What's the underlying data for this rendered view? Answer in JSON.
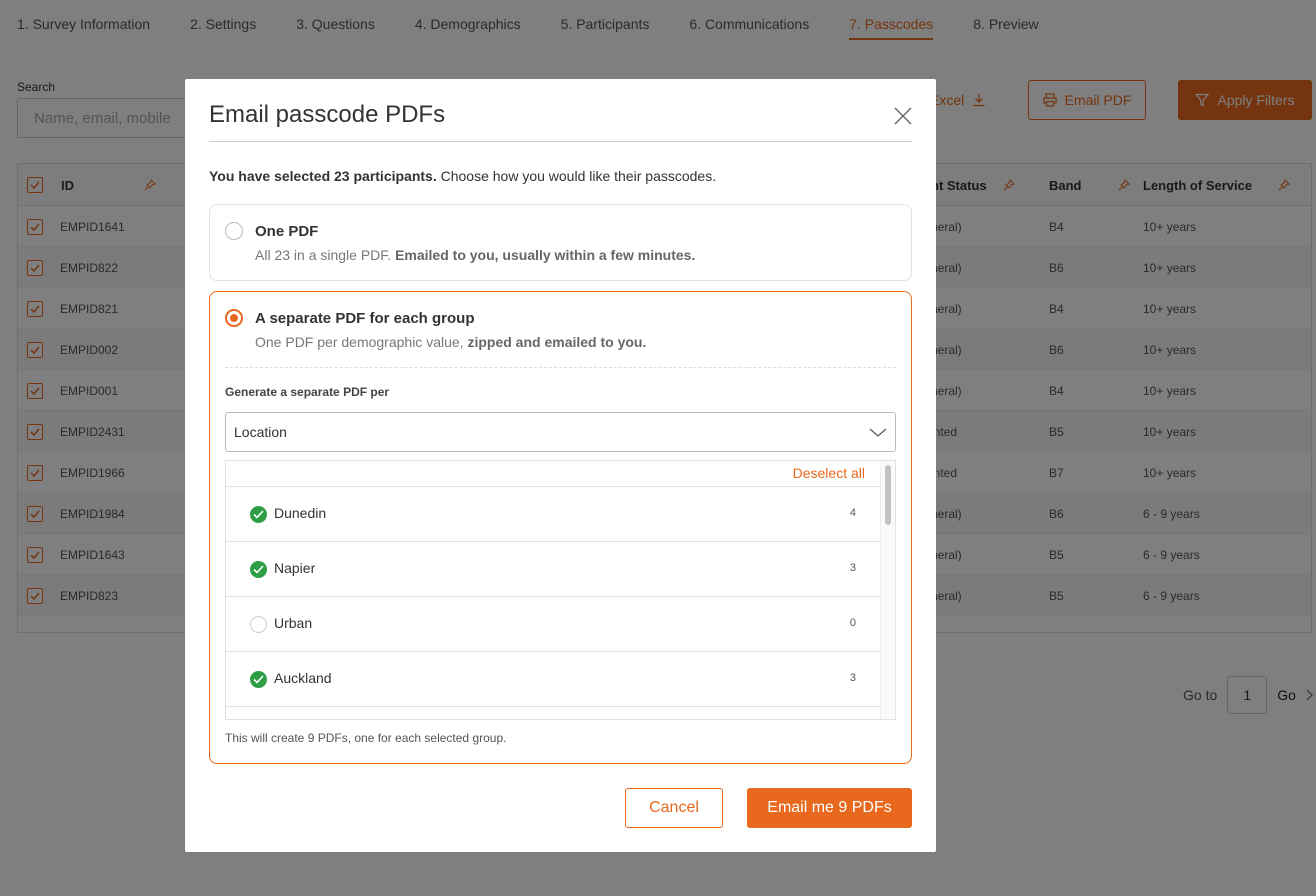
{
  "steps": [
    {
      "label": "1. Survey Information"
    },
    {
      "label": "2. Settings"
    },
    {
      "label": "3. Questions"
    },
    {
      "label": "4. Demographics"
    },
    {
      "label": "5. Participants"
    },
    {
      "label": "6. Communications"
    },
    {
      "label": "7. Passcodes",
      "active": true
    },
    {
      "label": "8. Preview"
    }
  ],
  "search": {
    "label": "Search",
    "placeholder": "Name, email, mobile"
  },
  "toolbar": {
    "excel_label": "Excel",
    "email_pdf_label": "Email PDF",
    "apply_filters_label": "Apply Filters"
  },
  "table": {
    "columns": {
      "id": "ID",
      "status": "nt Status",
      "band": "Band",
      "service": "Length of Service"
    },
    "rows": [
      {
        "id": "EMPID1641",
        "status": "neral)",
        "band": "B4",
        "service": "10+ years"
      },
      {
        "id": "EMPID822",
        "status": "neral)",
        "band": "B6",
        "service": "10+ years"
      },
      {
        "id": "EMPID821",
        "status": "neral)",
        "band": "B4",
        "service": "10+ years"
      },
      {
        "id": "EMPID002",
        "status": "neral)",
        "band": "B6",
        "service": "10+ years"
      },
      {
        "id": "EMPID001",
        "status": "neral)",
        "band": "B4",
        "service": "10+ years"
      },
      {
        "id": "EMPID2431",
        "status": "inted",
        "band": "B5",
        "service": "10+ years"
      },
      {
        "id": "EMPID1966",
        "status": "inted",
        "band": "B7",
        "service": "10+ years"
      },
      {
        "id": "EMPID1984",
        "status": "neral)",
        "band": "B6",
        "service": "6 - 9 years"
      },
      {
        "id": "EMPID1643",
        "status": "neral)",
        "band": "B5",
        "service": "6 - 9 years"
      },
      {
        "id": "EMPID823",
        "status": "neral)",
        "band": "B5",
        "service": "6 - 9 years"
      }
    ]
  },
  "pagination": {
    "goto_label": "Go to",
    "page": "1",
    "go_label": "Go"
  },
  "modal": {
    "title": "Email passcode PDFs",
    "intro_bold": "You have selected 23 participants.",
    "intro_rest": " Choose how you would like their passcodes.",
    "option_one": {
      "title": "One PDF",
      "desc_plain": "All 23 in a single PDF. ",
      "desc_bold": "Emailed to you, usually within a few minutes.",
      "selected": false
    },
    "option_group": {
      "title": "A separate PDF for each group",
      "desc_plain": "One PDF per demographic value, ",
      "desc_bold": "zipped and emailed to you.",
      "selected": true
    },
    "generate_label": "Generate a separate PDF per",
    "select_value": "Location",
    "deselect_all_label": "Deselect all",
    "groups": [
      {
        "label": "Dunedin",
        "count": "4",
        "checked": true
      },
      {
        "label": "Napier",
        "count": "3",
        "checked": true
      },
      {
        "label": "Urban",
        "count": "0",
        "checked": false
      },
      {
        "label": "Auckland",
        "count": "3",
        "checked": true
      }
    ],
    "summary": "This will create 9 PDFs, one for each selected group.",
    "cancel_label": "Cancel",
    "submit_label": "Email me 9 PDFs"
  },
  "colors": {
    "accent": "#e8681e",
    "check_green": "#2e9e45"
  }
}
